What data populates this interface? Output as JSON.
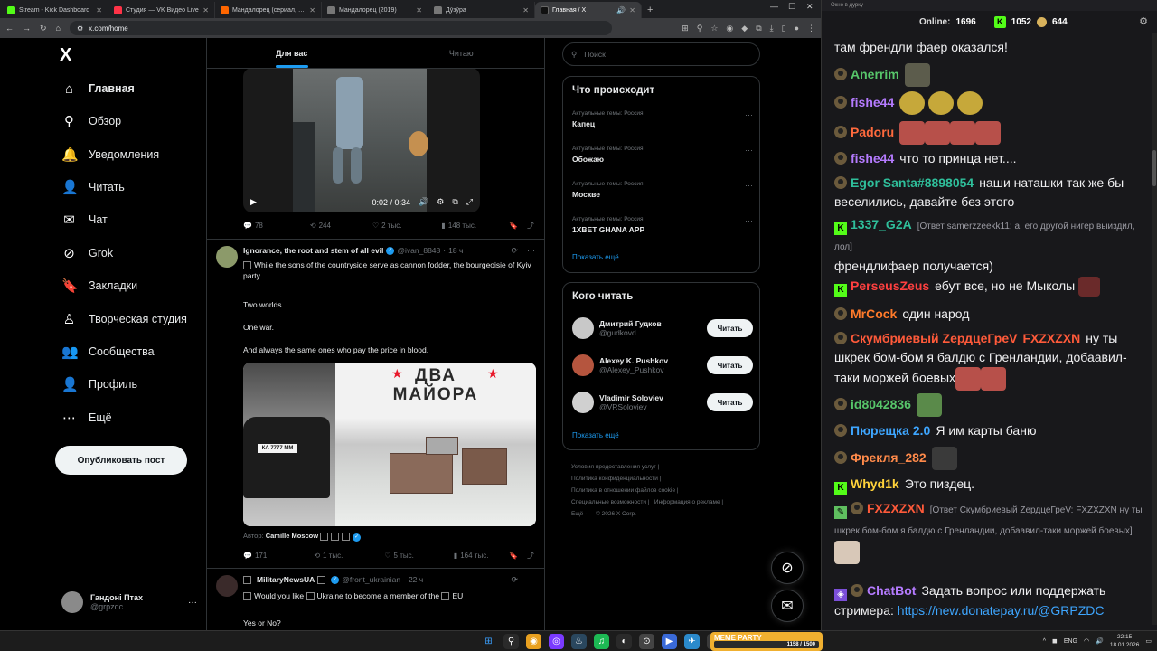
{
  "browser": {
    "tabs": [
      {
        "label": "Stream - Kick Dashboard",
        "color": "#53fc18"
      },
      {
        "label": "Студия — VK Видео Live",
        "color": "#ff3347"
      },
      {
        "label": "Мандалорец (сериал, 1-4 сез",
        "color": "#ff6600"
      },
      {
        "label": "Мандалорец (2019)",
        "color": "#777777"
      },
      {
        "label": "Дўзўра",
        "color": "#777777"
      },
      {
        "label": "Главная / X",
        "color": "#111111"
      }
    ],
    "url": "x.com/home"
  },
  "x": {
    "logo": "X",
    "nav": [
      {
        "label": "Главная",
        "icon": "home-icon",
        "glyph": "⌂"
      },
      {
        "label": "Обзор",
        "icon": "search-icon",
        "glyph": "⚲"
      },
      {
        "label": "Уведомления",
        "icon": "bell-icon",
        "glyph": "🔔"
      },
      {
        "label": "Читать",
        "icon": "person-add-icon",
        "glyph": "👤"
      },
      {
        "label": "Чат",
        "icon": "mail-icon",
        "glyph": "✉"
      },
      {
        "label": "Grok",
        "icon": "grok-icon",
        "glyph": "⊘"
      },
      {
        "label": "Закладки",
        "icon": "bookmark-icon",
        "glyph": "🔖"
      },
      {
        "label": "Творческая студия",
        "icon": "studio-icon",
        "glyph": "♙"
      },
      {
        "label": "Сообщества",
        "icon": "communities-icon",
        "glyph": "👥"
      },
      {
        "label": "Профиль",
        "icon": "profile-icon",
        "glyph": "👤"
      },
      {
        "label": "Ещё",
        "icon": "more-icon",
        "glyph": "⋯"
      }
    ],
    "post_button": "Опубликовать пост",
    "account": {
      "name": "Гандоні Птах",
      "handle": "@grpzdc"
    },
    "feed_tabs": [
      "Для вас",
      "Читаю"
    ],
    "video": {
      "time": "0:02 / 0:34"
    },
    "tweet1_stats": {
      "replies": "78",
      "reposts": "244",
      "likes": "2 тыс.",
      "views": "148 тыс."
    },
    "tweet2": {
      "name": "Ignorance, the root and stem of all evil",
      "handle": "@ivan_8848",
      "time": "18 ч",
      "lines": [
        "While the sons of the countryside serve as cannon fodder, the bourgeoisie of Kyiv party.",
        "Two worlds.",
        "One war.",
        "And always the same ones who pay the price in blood."
      ],
      "media_title_1": "ДВА",
      "media_title_2": "МАЙОРА",
      "plate": "КА 7777 ММ",
      "credit_label": "Автор:",
      "credit_name": "Camille Moscow",
      "stats": {
        "replies": "171",
        "reposts": "1 тыс.",
        "likes": "5 тыс.",
        "views": "164 тыс."
      }
    },
    "tweet3": {
      "name": "MilitaryNewsUA",
      "handle": "@front_ukrainian",
      "time": "22 ч",
      "text_a": "Would you like",
      "text_b": "Ukraine to become a member of the",
      "text_c": "EU",
      "text_d": "Yes or No?"
    },
    "search_placeholder": "Поиск",
    "trends": {
      "title": "Что происходит",
      "items": [
        {
          "category": "Актуальные темы: Россия",
          "topic": "Капец"
        },
        {
          "category": "Актуальные темы: Россия",
          "topic": "Обожаю"
        },
        {
          "category": "Актуальные темы: Россия",
          "topic": "Москве"
        },
        {
          "category": "Актуальные темы: Россия",
          "topic": "1XBET GHANA APP"
        }
      ],
      "show_more": "Показать ещё"
    },
    "who_to_follow": {
      "title": "Кого читать",
      "items": [
        {
          "name": "Дмитрий Гудков",
          "handle": "@gudkovd"
        },
        {
          "name": "Alexey K. Pushkov",
          "handle": "@Alexey_Pushkov"
        },
        {
          "name": "Vladimir Soloviev",
          "handle": "@VRSoloviev"
        }
      ],
      "follow_label": "Читать",
      "show_more": "Показать ещё"
    },
    "footer": {
      "terms": "Условия предоставления услуг",
      "privacy": "Политика конфиденциальности",
      "cookies": "Политика в отношении файлов cookie",
      "accessibility": "Специальные возможности",
      "ads": "Информация о рекламе",
      "more": "Ещё ···",
      "copyright": "© 2026 X Corp."
    }
  },
  "chat": {
    "window_title": "Окно в дурку",
    "online_label": "Online:",
    "online_count": "1696",
    "kick_count": "1052",
    "coin_count": "644",
    "messages": [
      {
        "user": "",
        "text": "там френдли фаер оказался!",
        "color": "#efeff1"
      },
      {
        "user": "Anerrim",
        "text": "",
        "color": "#57c66a"
      },
      {
        "user": "fishe44",
        "text": "",
        "color": "#b57bff"
      },
      {
        "user": "Padoru",
        "text": "",
        "color": "#ff6a3d"
      },
      {
        "user": "fishe44",
        "text": "что то принца нет....",
        "color": "#b57bff"
      },
      {
        "user": "Egor Santa#8898054",
        "text": "наши наташки так же бы веселились, давайте без этого",
        "color": "#2fbf9b"
      },
      {
        "user": "1337_G2A",
        "reply": "[Ответ samerzzeekk11: а, его другой нигер выиздил, лол]",
        "text": "френдлифаер получается)",
        "color": "#2fbf9b"
      },
      {
        "user": "PerseusZeus",
        "text": "ебут все, но не Мыколы",
        "color": "#ff4040"
      },
      {
        "user": "MrCock",
        "text": "один народ",
        "color": "#ff7a2a"
      },
      {
        "user": "Скумбриевый ZердцеГреV",
        "mention": "FXZXZXN",
        "text": "ну ты шкрек бом-бом я балдю с Гренландии, добаавил-таки моржей боевых",
        "color": "#ff5a3a"
      },
      {
        "user": "id8042836",
        "text": "",
        "color": "#57c66a"
      },
      {
        "user": "Пюрещка 2.0",
        "text": "Я им карты баню",
        "color": "#3ea6ff"
      },
      {
        "user": "Фрекля_282",
        "text": "",
        "color": "#ff8a4a"
      },
      {
        "user": "Whyd1k",
        "text": "Это пиздец.",
        "color": "#ffd23a"
      },
      {
        "user": "FXZXZXN",
        "reply": "[Ответ Скумбриевый ZердцеГреV: FXZXZXN ну ты шкрек бом-бом я балдю с Гренландии, добаавил-таки моржей боевых]",
        "text": "",
        "color": "#ff5a3a"
      },
      {
        "user": "ChatBot",
        "text": "Задать вопрос или поддержать стримера:",
        "link": "https://new.donatepay.ru/@GRPZDC",
        "color": "#b57bff"
      }
    ]
  },
  "taskbar": {
    "widget_title": "MEME PARTY",
    "widget_progress": "1158 / 1500",
    "lang": "ENG",
    "time": "22:15",
    "date": "18.01.2026"
  }
}
